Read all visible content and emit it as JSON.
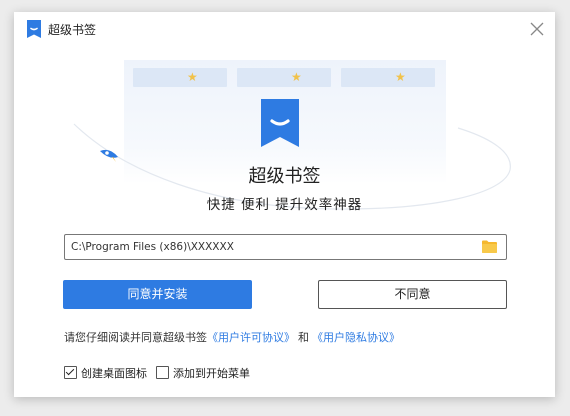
{
  "window": {
    "title": "超级书签"
  },
  "hero": {
    "app_name": "超级书签",
    "slogan": "快捷 便利 提升效率神器"
  },
  "install_path": {
    "value": "C:\\Program Files (x86)\\XXXXXX"
  },
  "buttons": {
    "agree_install": "同意并安装",
    "disagree": "不同意"
  },
  "agreement": {
    "prefix": "请您仔细阅读并同意超级书签",
    "license_link": "《用户许可协议》",
    "conjunction": "和",
    "privacy_link": "《用户隐私协议》"
  },
  "options": [
    {
      "label": "创建桌面图标",
      "checked": true
    },
    {
      "label": "添加到开始菜单",
      "checked": false
    }
  ],
  "colors": {
    "accent": "#2e7be2",
    "folder": "#f5b82e",
    "star": "#f1c24a"
  }
}
